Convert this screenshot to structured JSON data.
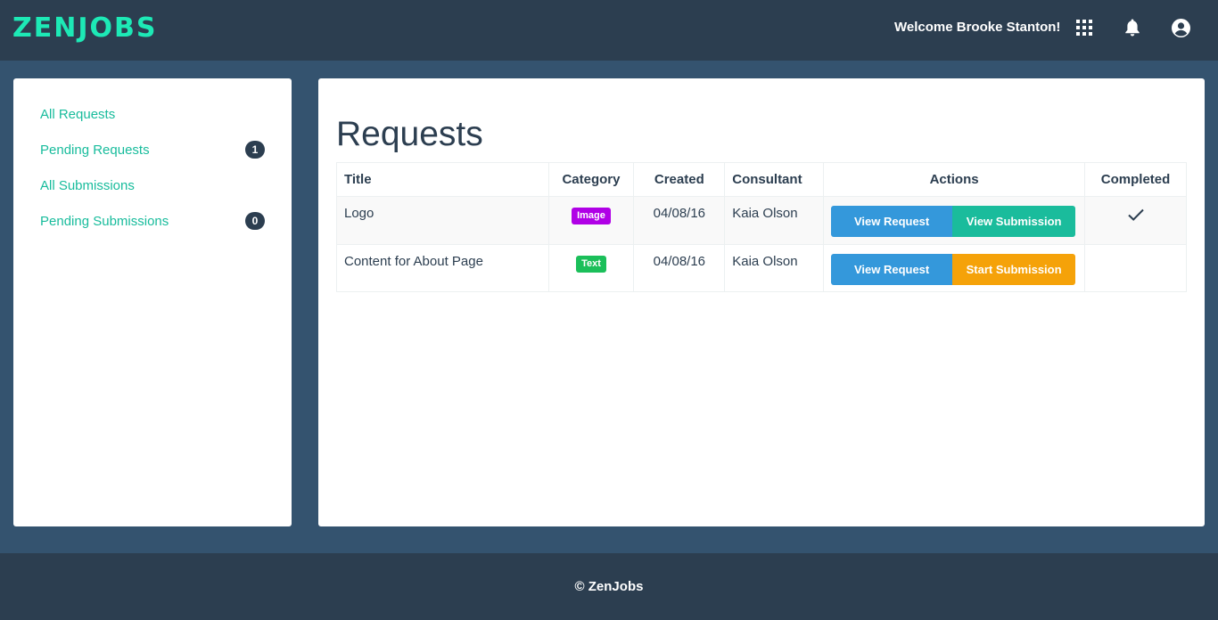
{
  "header": {
    "brand": "ZENJOBS",
    "welcome": "Welcome Brooke Stanton!",
    "icons": [
      "apps-grid-icon",
      "bell-icon",
      "user-circle-icon"
    ]
  },
  "sidebar": {
    "items": [
      {
        "label": "All Requests",
        "badge": null
      },
      {
        "label": "Pending Requests",
        "badge": "1"
      },
      {
        "label": "All Submissions",
        "badge": null
      },
      {
        "label": "Pending Submissions",
        "badge": "0"
      }
    ]
  },
  "main": {
    "title": "Requests",
    "columns": [
      "Title",
      "Category",
      "Created",
      "Consultant",
      "Actions",
      "Completed"
    ],
    "rows": [
      {
        "title": "Logo",
        "category": "Image",
        "category_color": "#b000e6",
        "created": "04/08/16",
        "consultant": "Kaia Olson",
        "action_primary": "View Request",
        "action_secondary": "View Submission",
        "completed": true
      },
      {
        "title": "Content for About Page",
        "category": "Text",
        "category_color": "#1bbf5a",
        "created": "04/08/16",
        "consultant": "Kaia Olson",
        "action_primary": "View Request",
        "action_secondary": "Start Submission",
        "completed": false
      }
    ]
  },
  "footer": {
    "text": "© ZenJobs"
  },
  "colors": {
    "navbar": "#2c3e50",
    "background": "#34536f",
    "brand": "#1de9b6",
    "link": "#18bc9c",
    "btn_blue": "#3498db",
    "btn_teal": "#1abc9c",
    "btn_orange": "#f5a209"
  }
}
